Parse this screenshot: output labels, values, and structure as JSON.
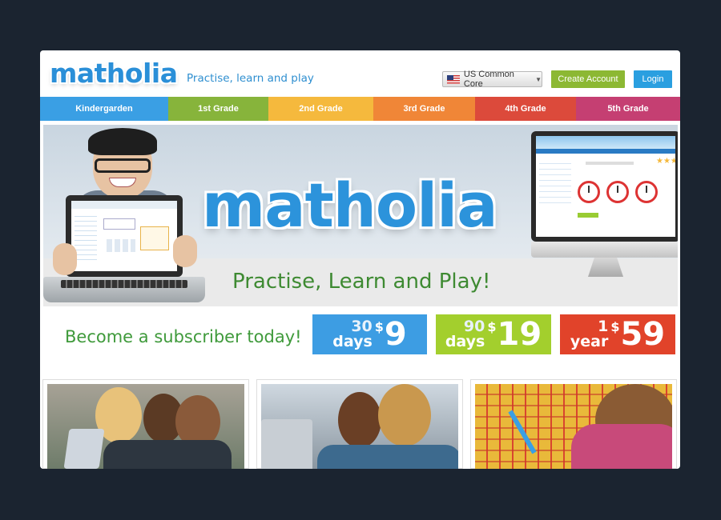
{
  "header": {
    "logo_text": "matholia",
    "tagline": "Practise, learn and play",
    "region_select": "US Common Core",
    "create_account_label": "Create Account",
    "login_label": "Login"
  },
  "grades": [
    {
      "label": "Kindergarden",
      "color": "#3a9fe4"
    },
    {
      "label": "1st Grade",
      "color": "#87b43b"
    },
    {
      "label": "2nd Grade",
      "color": "#f5b93d"
    },
    {
      "label": "3rd Grade",
      "color": "#f08637"
    },
    {
      "label": "4th Grade",
      "color": "#dc4a3b"
    },
    {
      "label": "5th Grade",
      "color": "#c53f72"
    }
  ],
  "hero": {
    "logo_text": "matholia",
    "tagline": "Practise, Learn and Play!"
  },
  "subscribe": {
    "headline": "Become a subscriber today!",
    "plans": [
      {
        "line1": "30",
        "line2": "days",
        "currency": "$",
        "price": "9"
      },
      {
        "line1": "90",
        "line2": "days",
        "currency": "$",
        "price": "19"
      },
      {
        "line1": "1",
        "line2": "year",
        "currency": "$",
        "price": "59"
      }
    ]
  },
  "colors": {
    "brand_blue": "#2c93db",
    "green": "#8cb833",
    "background": "#1b2430"
  }
}
